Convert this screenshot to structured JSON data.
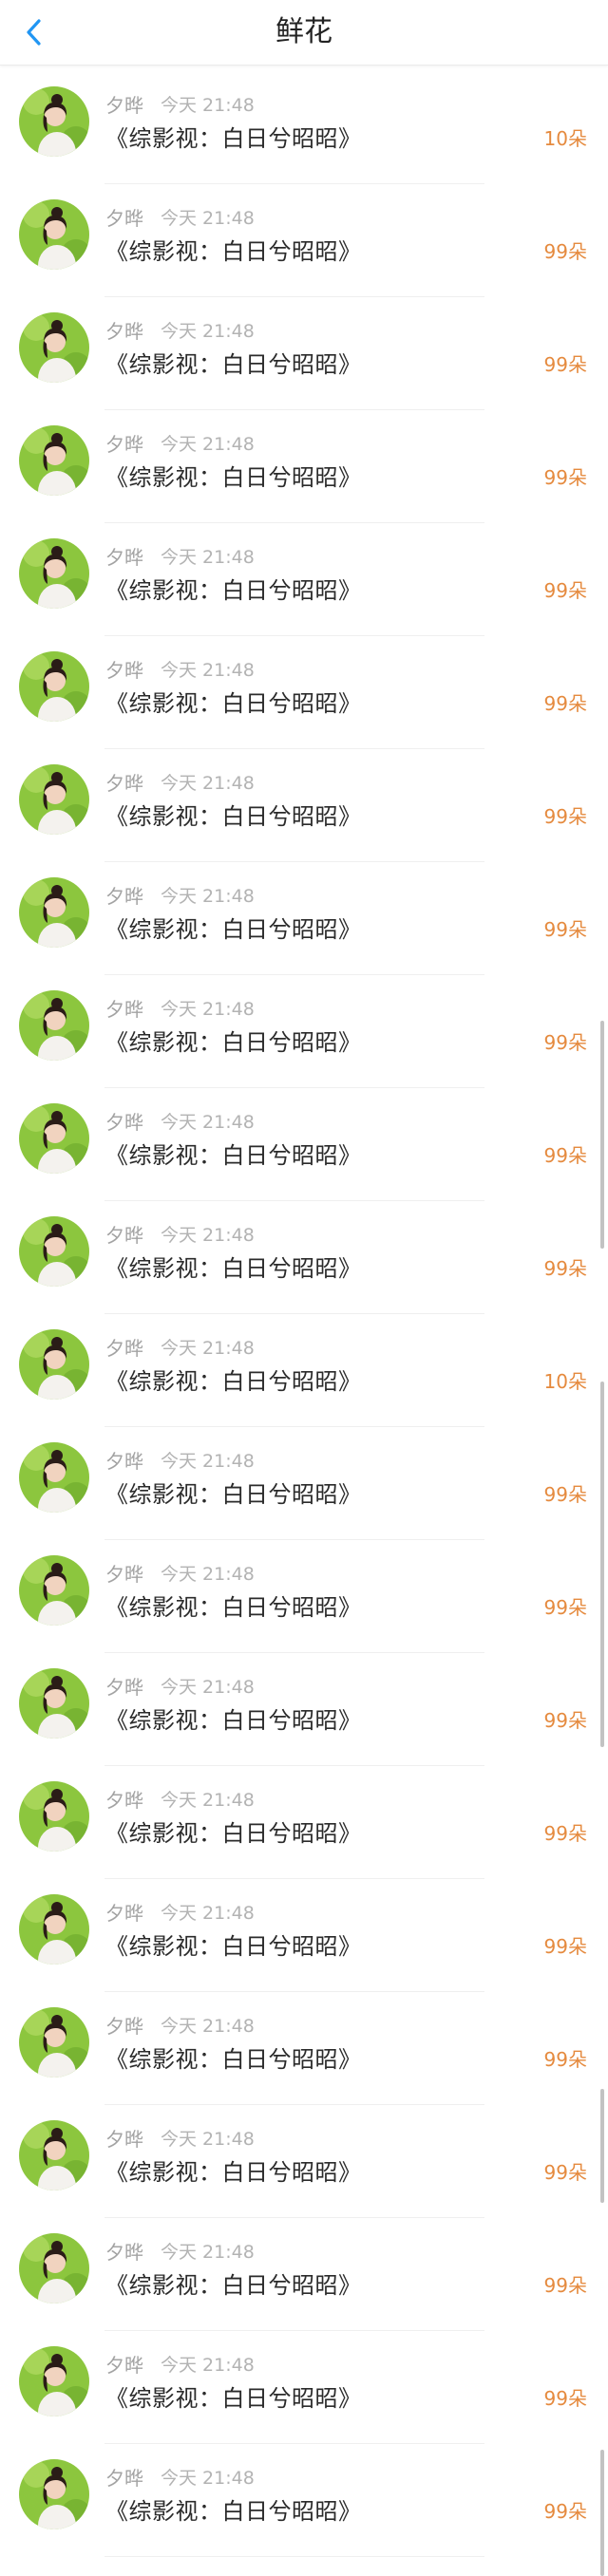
{
  "header": {
    "title": "鲜花",
    "back_icon": "chevron-left-icon",
    "accent_color": "#2196f3"
  },
  "colors": {
    "count": "#e58a3e",
    "username": "#a3a3a3"
  },
  "items": [
    {
      "username": "夕晔",
      "time": "今天 21:48",
      "gift": "《综影视：白日兮昭昭》",
      "count": "10朵"
    },
    {
      "username": "夕晔",
      "time": "今天 21:48",
      "gift": "《综影视：白日兮昭昭》",
      "count": "99朵"
    },
    {
      "username": "夕晔",
      "time": "今天 21:48",
      "gift": "《综影视：白日兮昭昭》",
      "count": "99朵"
    },
    {
      "username": "夕晔",
      "time": "今天 21:48",
      "gift": "《综影视：白日兮昭昭》",
      "count": "99朵"
    },
    {
      "username": "夕晔",
      "time": "今天 21:48",
      "gift": "《综影视：白日兮昭昭》",
      "count": "99朵"
    },
    {
      "username": "夕晔",
      "time": "今天 21:48",
      "gift": "《综影视：白日兮昭昭》",
      "count": "99朵"
    },
    {
      "username": "夕晔",
      "time": "今天 21:48",
      "gift": "《综影视：白日兮昭昭》",
      "count": "99朵"
    },
    {
      "username": "夕晔",
      "time": "今天 21:48",
      "gift": "《综影视：白日兮昭昭》",
      "count": "99朵"
    },
    {
      "username": "夕晔",
      "time": "今天 21:48",
      "gift": "《综影视：白日兮昭昭》",
      "count": "99朵"
    },
    {
      "username": "夕晔",
      "time": "今天 21:48",
      "gift": "《综影视：白日兮昭昭》",
      "count": "99朵"
    },
    {
      "username": "夕晔",
      "time": "今天 21:48",
      "gift": "《综影视：白日兮昭昭》",
      "count": "99朵"
    },
    {
      "username": "夕晔",
      "time": "今天 21:48",
      "gift": "《综影视：白日兮昭昭》",
      "count": "10朵"
    },
    {
      "username": "夕晔",
      "time": "今天 21:48",
      "gift": "《综影视：白日兮昭昭》",
      "count": "99朵"
    },
    {
      "username": "夕晔",
      "time": "今天 21:48",
      "gift": "《综影视：白日兮昭昭》",
      "count": "99朵"
    },
    {
      "username": "夕晔",
      "time": "今天 21:48",
      "gift": "《综影视：白日兮昭昭》",
      "count": "99朵"
    },
    {
      "username": "夕晔",
      "time": "今天 21:48",
      "gift": "《综影视：白日兮昭昭》",
      "count": "99朵"
    },
    {
      "username": "夕晔",
      "time": "今天 21:48",
      "gift": "《综影视：白日兮昭昭》",
      "count": "99朵"
    },
    {
      "username": "夕晔",
      "time": "今天 21:48",
      "gift": "《综影视：白日兮昭昭》",
      "count": "99朵"
    },
    {
      "username": "夕晔",
      "time": "今天 21:48",
      "gift": "《综影视：白日兮昭昭》",
      "count": "99朵"
    },
    {
      "username": "夕晔",
      "time": "今天 21:48",
      "gift": "《综影视：白日兮昭昭》",
      "count": "99朵"
    },
    {
      "username": "夕晔",
      "time": "今天 21:48",
      "gift": "《综影视：白日兮昭昭》",
      "count": "99朵"
    },
    {
      "username": "夕晔",
      "time": "今天 21:48",
      "gift": "《综影视：白日兮昭昭》",
      "count": "99朵"
    }
  ]
}
